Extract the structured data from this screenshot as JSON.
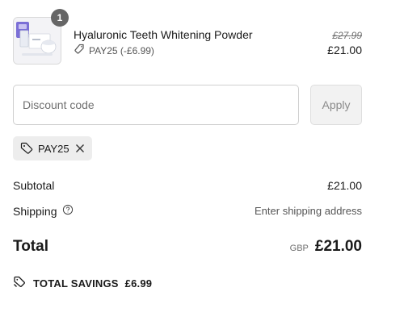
{
  "product": {
    "quantity": "1",
    "name": "Hyaluronic Teeth Whitening Powder",
    "discount_line": "PAY25 (-£6.99)",
    "original_price": "£27.99",
    "final_price": "£21.00"
  },
  "discount": {
    "placeholder": "Discount code",
    "apply_label": "Apply",
    "applied_code": "PAY25"
  },
  "summary": {
    "subtotal_label": "Subtotal",
    "subtotal_value": "£21.00",
    "shipping_label": "Shipping",
    "shipping_value": "Enter shipping address",
    "total_label": "Total",
    "currency": "GBP",
    "total_value": "£21.00",
    "savings_label": "TOTAL SAVINGS",
    "savings_value": "£6.99"
  },
  "icons": {
    "tag": "tag-icon",
    "close": "close-icon",
    "help": "help-circle-icon",
    "savings": "double-tag-icon"
  }
}
